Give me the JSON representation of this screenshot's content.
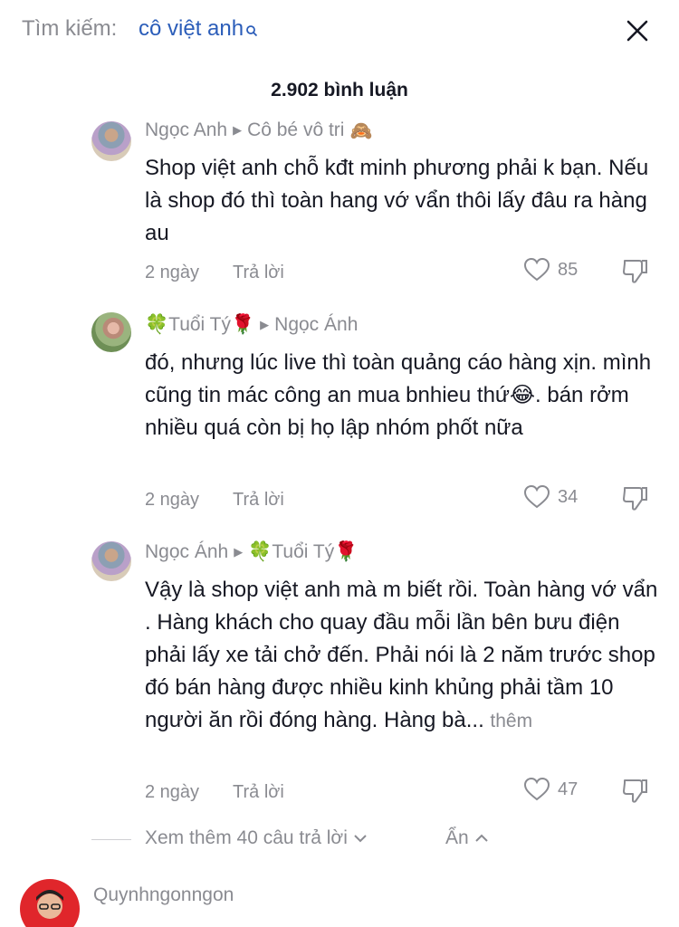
{
  "search": {
    "prefix": "Tìm kiếm:",
    "query": "cô việt anh"
  },
  "comments_count": "2.902 bình luận",
  "replies": [
    {
      "user": "Ngọc Anh",
      "reply_to": "Cô bé vô tri",
      "reply_to_emoji": "🙈",
      "text": "Shop việt anh chỗ kđt minh phương phải k bạn. Nếu là shop đó thì toàn hang vớ vẩn thôi lấy đâu ra hàng au",
      "time": "2 ngày",
      "reply_label": "Trả lời",
      "likes": "85"
    },
    {
      "user": "🍀Tuổi Tý🌹",
      "reply_to": "Ngọc Ánh",
      "text": "đó, nhưng lúc live thì toàn quảng cáo hàng xịn. mình cũng tin mác công an mua bnhieu thứ😂. bán rởm nhiều quá còn bị họ lập nhóm phốt nữa",
      "time": "2 ngày",
      "reply_label": "Trả lời",
      "likes": "34"
    },
    {
      "user": "Ngọc Ánh",
      "reply_to": "🍀Tuổi Tý🌹",
      "text": "Vậy là shop việt anh mà m biết rồi. Toàn hàng vớ vẩn . Hàng khách cho quay đầu mỗi lần bên bưu điện phải lấy xe tải chở đến. Phải nói là 2 năm trước shop đó bán hàng được nhiều kinh khủng phải tầm 10 người ăn rồi đóng hàng. Hàng bà...",
      "more": "thêm",
      "time": "2 ngày",
      "reply_label": "Trả lời",
      "likes": "47"
    }
  ],
  "view_more": "Xem thêm 40 câu trả lời",
  "hide": "Ẩn",
  "next_comment": {
    "user": "Quynhngonngon"
  },
  "colors": {
    "accent": "#2b5db9",
    "secondary_text": "#8a8b91",
    "primary_text": "#161823"
  },
  "icons": [
    "magnifier-icon",
    "close-icon",
    "triangle-right-icon",
    "heart-icon",
    "dislike-icon",
    "chevron-down-icon",
    "chevron-up-icon"
  ]
}
